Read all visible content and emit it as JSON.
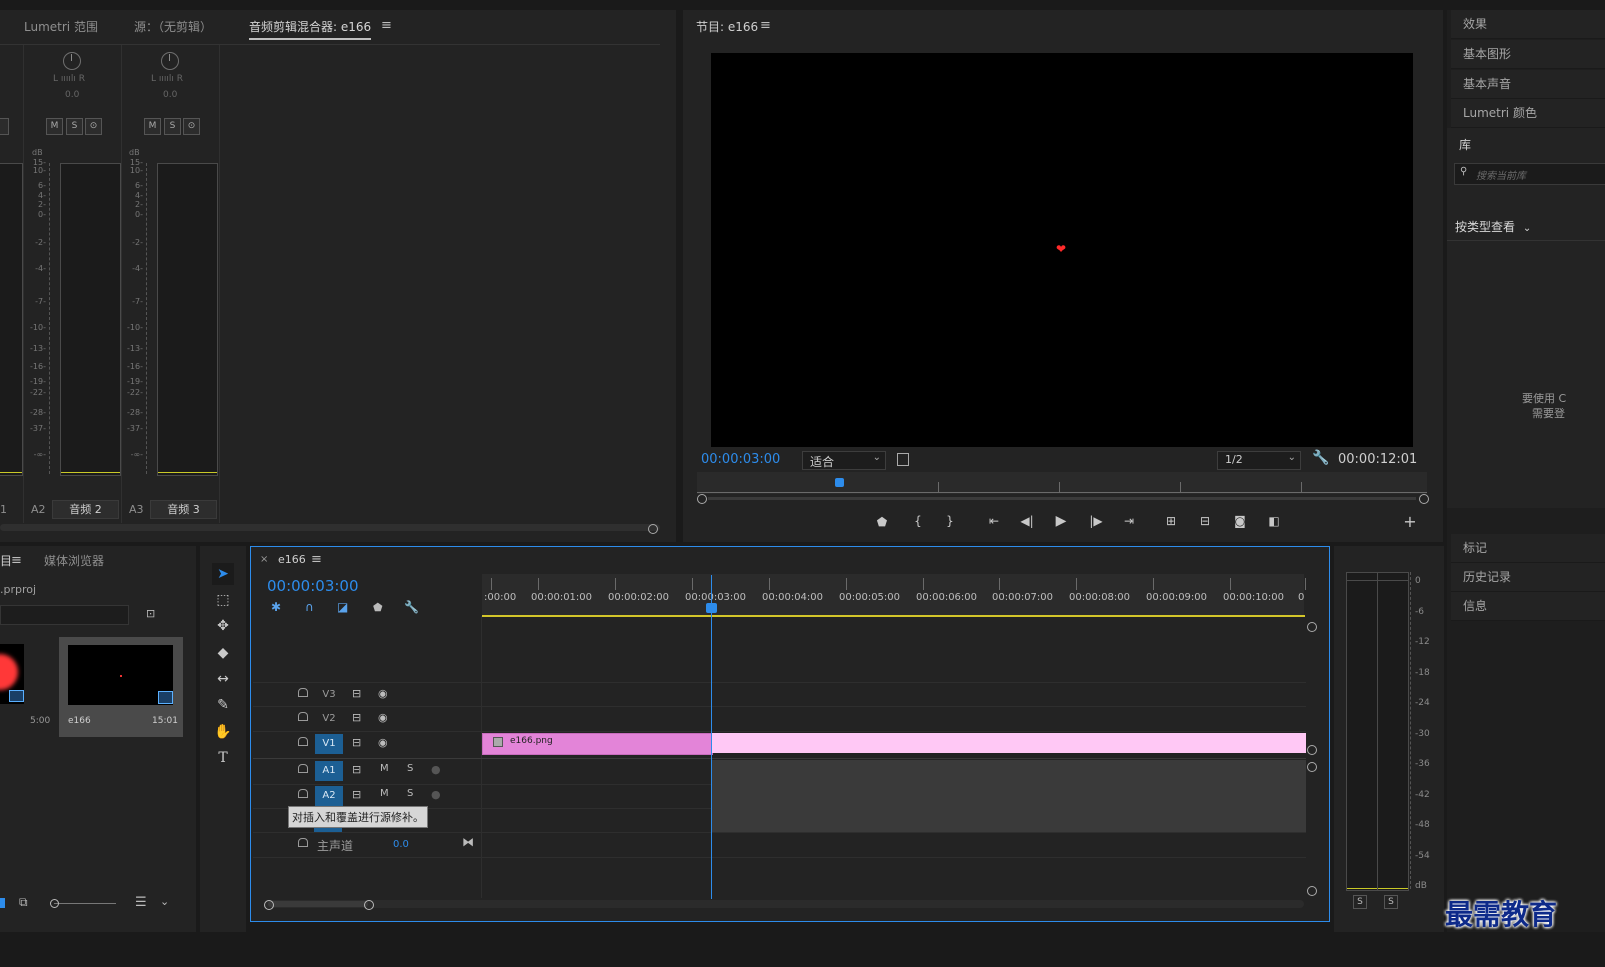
{
  "mixer_panel": {
    "tabs": [
      "Lumetri 范围",
      "源：（无剪辑）",
      "音频剪辑混合器: e166"
    ],
    "pan_lr": "L ıııılı R",
    "pan_value": "0.0",
    "mute": "M",
    "solo": "S",
    "record": "⊙",
    "db_label": "dB",
    "db_scale": [
      "15",
      "10",
      "6",
      "4",
      "2",
      "0",
      "-2",
      "-4",
      "-7",
      "-10",
      "-13",
      "-16",
      "-19",
      "-22",
      "-28",
      "-37",
      "-∞"
    ],
    "channels": [
      {
        "id": "1",
        "name": ""
      },
      {
        "id": "A2",
        "name": "音频 2"
      },
      {
        "id": "A3",
        "name": "音频 3"
      }
    ]
  },
  "program_monitor": {
    "title": "节目: e166",
    "current_time": "00:00:03:00",
    "fit_option": "适合",
    "resolution": "1/2",
    "duration": "00:00:12:01",
    "accent_color": "#2d8ceb"
  },
  "right_panel": {
    "items_top": [
      "效果",
      "基本图形",
      "基本声音",
      "Lumetri 颜色",
      "库"
    ],
    "search_placeholder": "搜索当前库",
    "view_by_type": "按类型查看",
    "login_note_1": "要使用 C",
    "login_note_2": "需要登",
    "items_bottom": [
      "标记",
      "历史记录",
      "信息"
    ]
  },
  "project_panel": {
    "tab_partial": "目",
    "tab_media": "媒体浏览器",
    "project_file": ".prproj",
    "thumb1_duration": "5:00",
    "thumb2_name": "e166",
    "thumb2_duration": "15:01"
  },
  "timeline": {
    "sequence": "e166",
    "timecode": "00:00:03:00",
    "ruler_labels": [
      ":00:00",
      "00:00:01:00",
      "00:00:02:00",
      "00:00:03:00",
      "00:00:04:00",
      "00:00:05:00",
      "00:00:06:00",
      "00:00:07:00",
      "00:00:08:00",
      "00:00:09:00",
      "00:00:10:00",
      "0"
    ],
    "tracks": [
      {
        "id": "V3",
        "kind": "video",
        "active": false
      },
      {
        "id": "V2",
        "kind": "video",
        "active": false
      },
      {
        "id": "V1",
        "kind": "video",
        "active": true
      },
      {
        "id": "A1",
        "kind": "audio",
        "active": true
      },
      {
        "id": "A2",
        "kind": "audio",
        "active": true
      }
    ],
    "mute": "M",
    "solo": "S",
    "master_label": "主声道",
    "master_value": "0.0",
    "clip_name": "e166.png",
    "clip_color": "#e384d8",
    "clip_selected_color": "#ffc8f5",
    "tooltip": "对插入和覆盖进行源修补。"
  },
  "audio_meter": {
    "scale": [
      "0",
      "-6",
      "-12",
      "-18",
      "-24",
      "-30",
      "-36",
      "-42",
      "-48",
      "-54",
      "dB"
    ],
    "solo_left": "S",
    "solo_right": "S"
  },
  "watermark": "最需教育"
}
